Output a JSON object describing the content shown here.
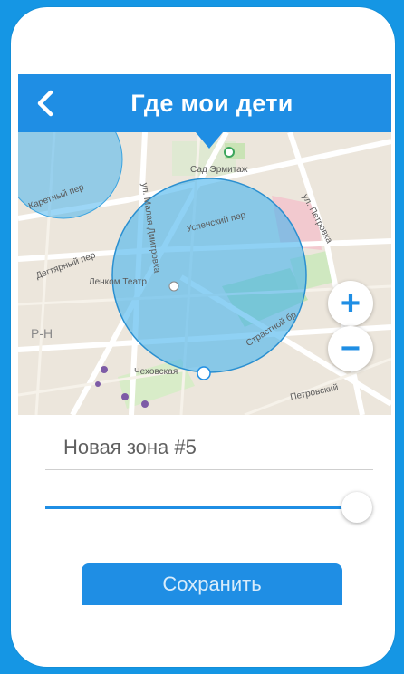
{
  "header": {
    "title": "Где мои дети"
  },
  "map": {
    "labels": {
      "garden": "Сад Эрмитаж",
      "street_petrovka": "ул. Петровка",
      "street_uspensky": "Успенский пер",
      "street_daev": "Дегтярный пер",
      "street_mal_dmitr": "ул. Малая Дмитровка",
      "theatre": "Ленком Театр",
      "square": "Страстной бр",
      "metro": "Чеховская",
      "petrovsky": "Петровский",
      "ph": "P-H",
      "karetny": "Каретный пер"
    },
    "zoom_in": "+",
    "zoom_out": "−"
  },
  "form": {
    "zone_name_value": "Новая зона #5",
    "save_label": "Сохранить",
    "radius_fraction": 0.95
  },
  "colors": {
    "background": "#1596e4",
    "accent": "#1f8ee4",
    "zone_fill": "#4ab4ee"
  }
}
